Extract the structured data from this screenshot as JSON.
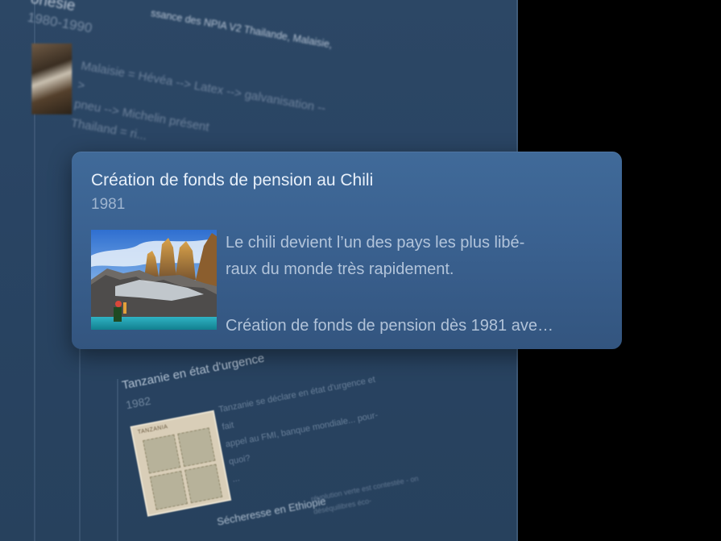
{
  "timeline": {
    "top_item": {
      "title": "onésie",
      "subtitle": "ssance des NPIA V2 Thailande, Malaisie,",
      "year": "1980-1990",
      "body_line1": "Malaisie = Hévéa --> Latex --> galvanisation -->",
      "body_line2": "pneu --> Michelin présent",
      "body_line3": "Thailand = ri..."
    },
    "selected_item": {
      "title": "Création de fonds de pension au Chili",
      "year": "1981",
      "desc_line1": "Le chili devient l’un des pays les plus libé-",
      "desc_line2": "raux du monde très rapidement.",
      "desc_line3": "Création de fonds de pension dès 1981 ave…"
    },
    "tanzania_item": {
      "title": "Tanzanie en état d'urgence",
      "year": "1982",
      "stamp_heading": "TANZANIA",
      "body_line1": "Tanzanie se déclare en état d'urgence et fait",
      "body_line2": "appel au FMI, banque mondiale... pour-",
      "body_line3": "quoi?",
      "body_line4": "..."
    },
    "ethiopia_item": {
      "title": "Sécheresse en Ethiopie",
      "snippet_line1": "révolution verte est contestée - on",
      "snippet_line2": "déséquilibres éco-"
    }
  },
  "colors": {
    "panel_bg": "#2a4564",
    "card_bg": "#3b6291",
    "outside_bg": "#000000"
  }
}
